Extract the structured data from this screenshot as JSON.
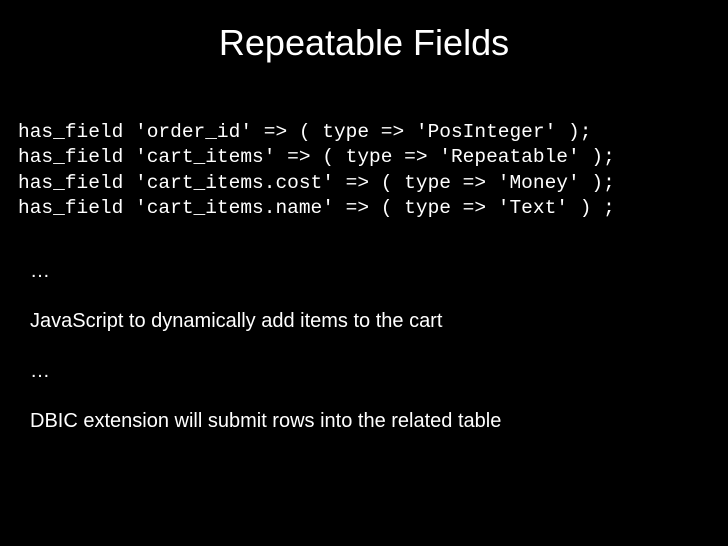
{
  "title": "Repeatable Fields",
  "code": {
    "line1": "has_field 'order_id' => ( type => 'PosInteger' );",
    "line2": "has_field 'cart_items' => ( type => 'Repeatable' );",
    "line3": "has_field 'cart_items.cost' => ( type => 'Money' );",
    "line4": "has_field 'cart_items.name' => ( type => 'Text' ) ;"
  },
  "body": {
    "ellipsis1": "…",
    "line1": "JavaScript to dynamically add items to the cart",
    "ellipsis2": "…",
    "line2": "DBIC extension will submit rows into the related table"
  }
}
